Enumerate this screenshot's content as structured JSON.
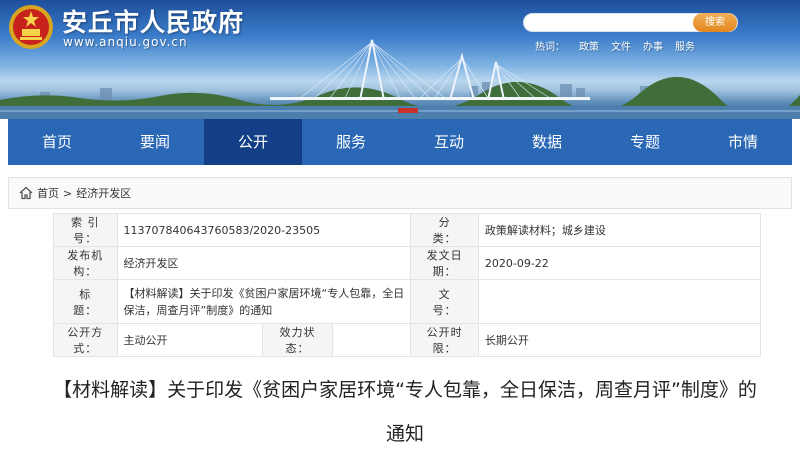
{
  "header": {
    "site_title": "安丘市人民政府",
    "site_url": "www.anqiu.gov.cn",
    "search": {
      "placeholder": "",
      "button_label": "搜索"
    },
    "hotwords_label": "热词：",
    "hotwords": [
      "政策",
      "文件",
      "办事",
      "服务"
    ]
  },
  "nav": {
    "items": [
      "首页",
      "要闻",
      "公开",
      "服务",
      "互动",
      "数据",
      "专题",
      "市情"
    ],
    "active_index": 2
  },
  "breadcrumb": {
    "items": [
      "首页",
      "经济开发区"
    ],
    "separator": ">"
  },
  "meta": {
    "index_label": "索 引 号：",
    "index_value": "113707840643760583/2020-23505",
    "category_label": "分　　类：",
    "category_value": "政策解读材料；城乡建设",
    "publisher_label": "发布机构：",
    "publisher_value": "经济开发区",
    "date_label": "发文日期：",
    "date_value": "2020-09-22",
    "title_label": "标　　题：",
    "title_value": "【材料解读】关于印发《贫困户家居环境“专人包靠，全日保洁，周查月评”制度》的通知",
    "docno_label": "文　　号：",
    "docno_value": "",
    "mode_label": "公开方式：",
    "mode_value": "主动公开",
    "validity_label": "效力状态：",
    "validity_value": "",
    "period_label": "公开时限：",
    "period_value": "长期公开"
  },
  "article": {
    "title": "【材料解读】关于印发《贫困户家居环境“专人包靠，全日保洁，周查月评”制度》的通知"
  },
  "colors": {
    "nav_bg": "#2a67b5",
    "nav_active": "#123f85",
    "search_button": "#e3861c"
  }
}
